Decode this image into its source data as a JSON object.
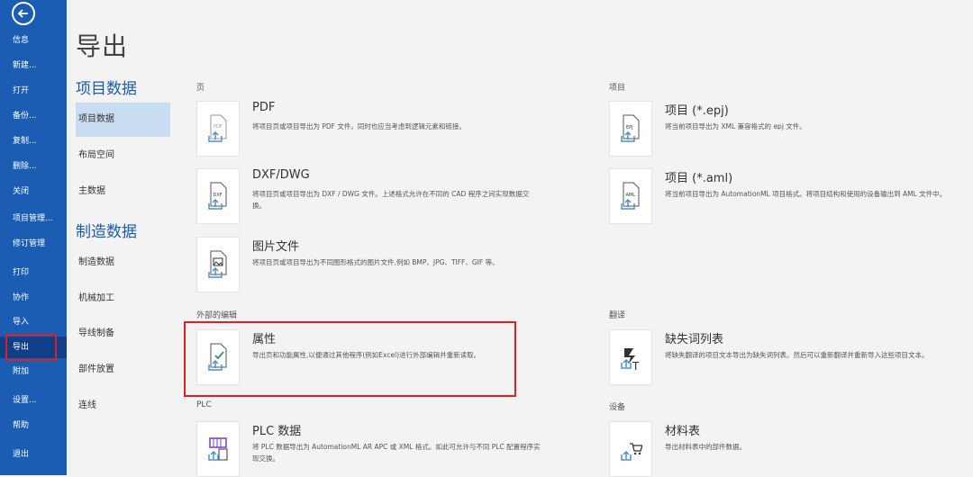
{
  "nav": {
    "items": [
      "信息",
      "新建...",
      "打开",
      "备份...",
      "复制...",
      "删除...",
      "关闭",
      "项目管理...",
      "修订管理",
      "打印",
      "协作",
      "导入",
      "导出",
      "附加",
      "设置...",
      "帮助",
      "退出"
    ],
    "active_index": 12
  },
  "page_title": "导出",
  "categories": {
    "project_head": "项目数据",
    "project_items": [
      "项目数据",
      "布局空间",
      "主数据"
    ],
    "mfg_head": "制造数据",
    "mfg_items": [
      "制造数据",
      "机械加工",
      "导线制备",
      "部件放置",
      "连线"
    ]
  },
  "sections": {
    "page": "页",
    "project": "项目",
    "external": "外部的编辑",
    "translate": "翻译",
    "plc": "PLC",
    "device": "设备"
  },
  "cards": {
    "pdf": {
      "title": "PDF",
      "desc": "将项目页或项目导出为 PDF 文件。同时也应当考虑到逻辑元素和链接。"
    },
    "dxf": {
      "title": "DXF/DWG",
      "desc": "将项目页或项目导出为 DXF / DWG 文件。上述格式允许在不同的 CAD 程序之间实现数据交换。"
    },
    "img": {
      "title": "图片文件",
      "desc": "将项目页或项目导出为不同图形格式的图片文件,例如 BMP、JPG、TIFF、GIF 等。"
    },
    "prop": {
      "title": "属性",
      "desc": "导出页和功能属性,以便通过其他程序(例如Excel)进行外部编辑并重新读取。"
    },
    "plc": {
      "title": "PLC 数据",
      "desc": "将 PLC 数据导出为 AutomationML AR APC 或 XML 格式。如此可允许与不同 PLC 配置程序实现交换。"
    },
    "epj": {
      "title": "项目 (*.epj)",
      "desc": "将当前项目导出为 XML 兼容格式的 epj 文件。"
    },
    "aml": {
      "title": "项目 (*.aml)",
      "desc": "将当前项目导出为 AutomationML 项目格式。将项目结构和使用的设备输出到 AML 文件中。"
    },
    "missing": {
      "title": "缺失词列表",
      "desc": "将缺失翻译的项目文本导出为缺失词列表。然后可以重新翻译并重新导入这些项目文本。"
    },
    "bom": {
      "title": "材料表",
      "desc": "导出材料表中的部件数据。"
    }
  },
  "icons": {
    "back": "back-arrow-icon",
    "pdf": "pdf-export-icon",
    "dxf": "dxf-export-icon",
    "img": "image-export-icon",
    "prop": "properties-export-icon",
    "plc": "plc-export-icon",
    "epj": "epj-export-icon",
    "aml": "aml-export-icon",
    "missing": "translation-export-icon",
    "bom": "bom-export-icon"
  },
  "colors": {
    "nav": "#1b5db3",
    "accent": "#1b5db3",
    "highlight": "#e02020"
  }
}
